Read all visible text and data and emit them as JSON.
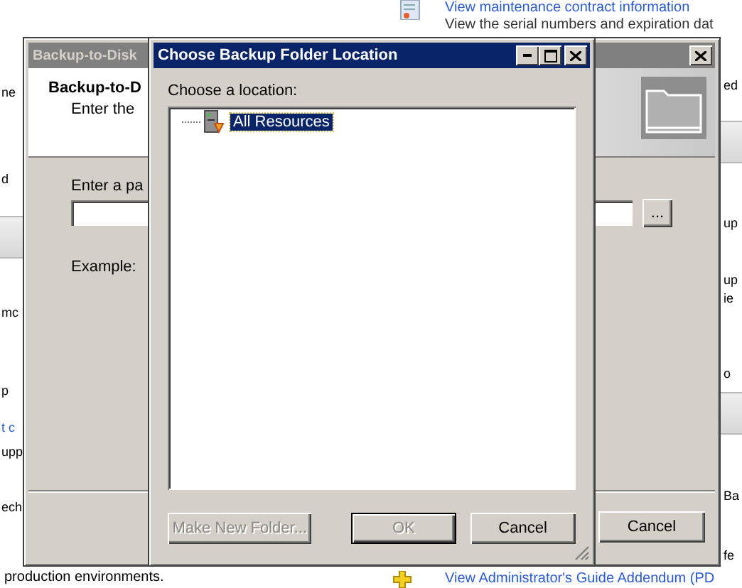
{
  "page": {
    "top_link": "View maintenance contract information",
    "top_text": "View the serial numbers and expiration dat",
    "left_fragments": [
      {
        "text": "ne",
        "kind": "text"
      },
      {
        "text": "d",
        "kind": "text"
      },
      {
        "text": "mc",
        "kind": "text"
      },
      {
        "text": "p",
        "kind": "text"
      },
      {
        "text": "t c",
        "kind": "link"
      },
      {
        "text": "upp",
        "kind": "text"
      },
      {
        "text": "ech",
        "kind": "text"
      }
    ],
    "right_fragments": [
      "ed",
      "up",
      "up",
      "ie",
      "o",
      "Ba",
      "fe"
    ],
    "bottom_text": "production environments.",
    "bottom_link": "View Administrator's Guide Addendum (PD"
  },
  "wizard": {
    "title": "Backup-to-Disk",
    "heading": "Backup-to-D",
    "subheading": "Enter the",
    "path_label": "Enter a pa",
    "example_label": "Example:",
    "browse_button": "...",
    "cancel_button": "Cancel"
  },
  "folder_dialog": {
    "title": "Choose Backup Folder Location",
    "prompt": "Choose a location:",
    "tree": [
      {
        "label": "All Resources",
        "selected": true
      }
    ],
    "buttons": [
      {
        "label": "Make New Folder...",
        "disabled": true,
        "default": false
      },
      {
        "label": "OK",
        "disabled": true,
        "default": true
      },
      {
        "label": "Cancel",
        "disabled": false,
        "default": false
      }
    ]
  }
}
